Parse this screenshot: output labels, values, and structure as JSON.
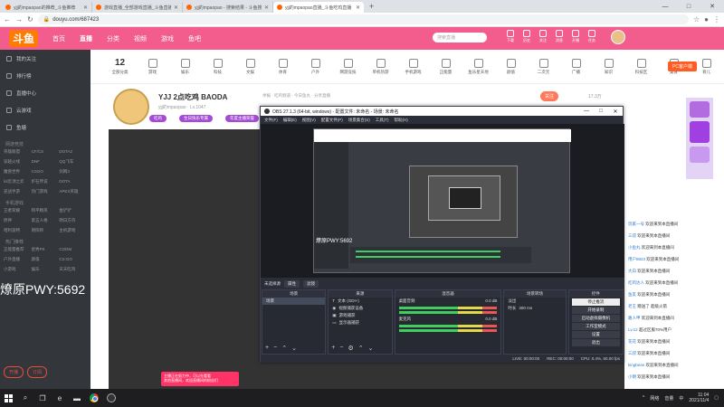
{
  "browser": {
    "tabs": [
      {
        "title": "yjj的mpaopao的推荐_斗鱼推荐"
      },
      {
        "title": "游戏直播_全部游戏直播_斗鱼直播"
      },
      {
        "title": "yjj的mpaopao - 搜索结果 - 斗鱼搜"
      },
      {
        "title": "yjj的mpaopao直播_斗鱼吃鸡直播"
      }
    ],
    "new_tab": "+",
    "url": "douyu.com/687423",
    "controls": {
      "min": "—",
      "max": "□",
      "close": "✕"
    }
  },
  "header": {
    "logo": "斗鱼",
    "nav": [
      "首页",
      "直播",
      "分类",
      "视频",
      "游戏",
      "鱼吧"
    ],
    "search_placeholder": "搜索直播",
    "icons": [
      "下载",
      "历史",
      "关注",
      "消息",
      "开播",
      "任务"
    ]
  },
  "sidebar": {
    "items": [
      "我的关注",
      "排行榜",
      "直播中心",
      "云游戏",
      "鱼塘"
    ],
    "sections": [
      {
        "title": "网游竞技",
        "games": [
          "英雄联盟",
          "CF/CS",
          "DOTA2",
          "穿越火线",
          "DNF",
          "QQ飞车",
          "魔兽世界",
          "CSGO",
          "剑网3",
          "lol云顶之弈",
          "炉石传说",
          "DOTA",
          "逆战手游",
          "热门游戏",
          "APEX英雄"
        ]
      },
      {
        "title": "手机游戏",
        "games": [
          "王者荣耀",
          "和平精英",
          "金铲铲",
          "原神",
          "第五人格",
          "明日方舟",
          "哈利波特",
          "阴阳师",
          "主机游戏"
        ]
      },
      {
        "title": "热门推荐",
        "games": [
          "正能量推荐",
          "星秀PK",
          "CODM",
          "户外直播",
          "颜值",
          "CS:GO",
          "小游戏",
          "娱乐",
          "天天吃鸡"
        ]
      }
    ],
    "buttons": [
      "开播",
      "订阅"
    ]
  },
  "categories": {
    "count": "12",
    "count_label": "全部分类",
    "items": [
      "游戏",
      "娱乐",
      "科技",
      "文娱",
      "体育",
      "户外",
      "网游竞技",
      "单机热游",
      "手机游戏",
      "正能量",
      "鱼乐星天地",
      "颜值",
      "二次元",
      "广播",
      "知识",
      "科技区",
      "美食",
      "育儿"
    ],
    "pc_button": "PC客户端"
  },
  "room": {
    "title": "YJJ 2点吃鸡 BAODA",
    "meta": "举报 · 吃鸡频道 · 今日鱼丸 · 分享直播",
    "subtitle": "yjj的mpaopao",
    "rank": "Lv.1047",
    "tags": [
      "吃鸡",
      "生日快乐专属",
      "年度主播荣誉",
      "粉丝团"
    ],
    "follow_label": "关注",
    "follow_count": "17.3万"
  },
  "player": {
    "overlay_text": "燎原PWY:5692",
    "bubble_lines": [
      "主播正在努力中，可以先看看",
      "其他直播间，欢迎直播间的粉丝们"
    ]
  },
  "obs": {
    "title": "OBS 27.1.3 (64-bit, windows) - 配置文件: 未命名 - 场景: 未命名",
    "menu": [
      "文件(F)",
      "编辑(E)",
      "视图(V)",
      "配置文件(P)",
      "场景集合(S)",
      "工具(T)",
      "帮助(H)"
    ],
    "inner_overlay": "燎原PWY:5692",
    "scene_bar": [
      "未选择源",
      "属性",
      "滤镜"
    ],
    "docks": {
      "scenes": {
        "title": "场景",
        "items": [
          "场景"
        ]
      },
      "sources": {
        "title": "来源",
        "items": [
          "文本 (GDI+)",
          "视频捕获设备",
          "游戏捕获",
          "显示器捕获"
        ]
      },
      "mixer": {
        "title": "混音器",
        "channels": [
          {
            "name": "桌面音频",
            "db": "0.0 dB"
          },
          {
            "name": "麦克风",
            "db": "0.0 dB"
          }
        ]
      },
      "transitions": {
        "title": "场景转场",
        "type": "淡出",
        "duration_label": "时长",
        "duration": "300 ms"
      },
      "controls": {
        "title": "控件",
        "buttons": [
          "停止推流",
          "开始录制",
          "启动虚拟摄像机",
          "工作室模式",
          "设置",
          "退出"
        ]
      }
    },
    "status": {
      "live": "LIVE: 00:00:00",
      "rec": "REC: 00:00:00",
      "cpu": "CPU: 0.4%, 60.00 fps"
    }
  },
  "chat": {
    "lines": [
      {
        "user": "玩家一号",
        "text": "欢迎来到本直播间"
      },
      {
        "user": "三叔",
        "text": "欢迎来到本直播间"
      },
      {
        "user": "小鱼丸",
        "text": "欢迎来到本直播间"
      },
      {
        "user": "用户8823",
        "text": "欢迎来到本直播间"
      },
      {
        "user": "大白",
        "text": "欢迎来到本直播间"
      },
      {
        "user": "吃鸡达人",
        "text": "欢迎来到本直播间"
      },
      {
        "user": "鱼友",
        "text": "欢迎来到本直播间"
      },
      {
        "user": "老王",
        "text": "赠送了 超级火箭"
      },
      {
        "user": "路人甲",
        "text": "欢迎来到本直播间"
      },
      {
        "user": "Lv.12",
        "text": "超过区服70%用户"
      },
      {
        "user": "花花",
        "text": "欢迎来到本直播间"
      },
      {
        "user": "三叔",
        "text": "欢迎来到本直播间"
      },
      {
        "user": "kingbean",
        "text": "欢迎来到本直播间"
      },
      {
        "user": "小明",
        "text": "欢迎来到本直播间"
      }
    ]
  },
  "taskbar": {
    "time": "11:04",
    "date": "2021/11/4",
    "tray": [
      "^",
      "网络",
      "音量",
      "中"
    ]
  }
}
